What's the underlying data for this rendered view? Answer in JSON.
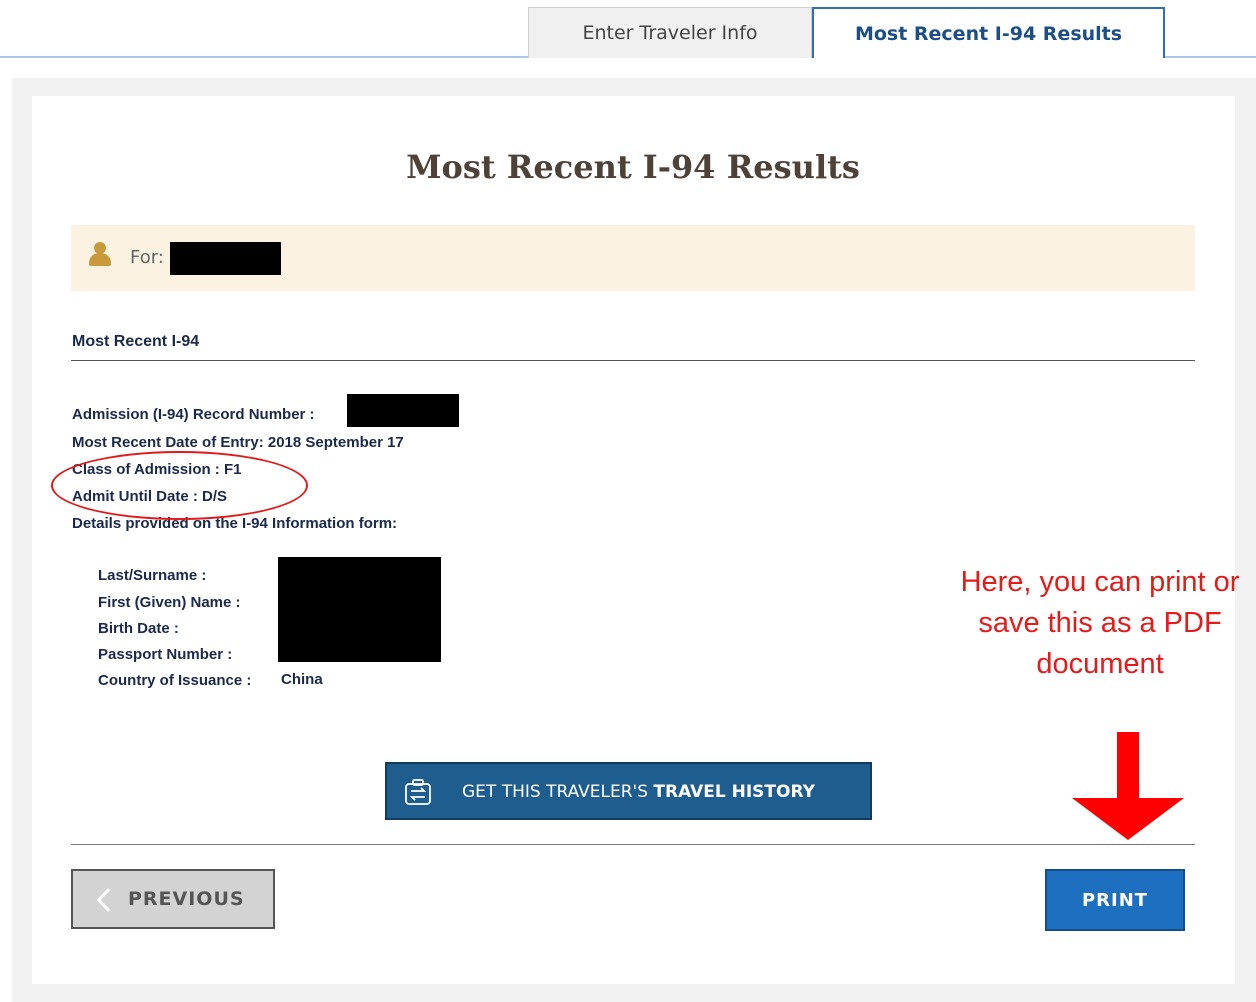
{
  "tabs": {
    "enter_traveler_info": "Enter Traveler Info",
    "most_recent_results": "Most Recent I-94 Results"
  },
  "page_title": "Most Recent I-94 Results",
  "for_banner": {
    "label": "For:",
    "icon": "user-icon"
  },
  "section": {
    "title": "Most Recent I-94",
    "record_number_label": "Admission (I-94) Record Number :",
    "date_of_entry": "Most Recent Date of Entry: 2018 September 17",
    "class_of_admission": "Class of Admission : F1",
    "admit_until": "Admit Until Date : D/S",
    "details_intro": "Details provided on the I-94 Information form:",
    "fields": [
      {
        "label": "Last/Surname :"
      },
      {
        "label": "First (Given) Name :"
      },
      {
        "label": "Birth Date :"
      },
      {
        "label": "Passport Number :"
      },
      {
        "label": "Country of Issuance :",
        "value": "China"
      }
    ]
  },
  "annotation": {
    "line1": "Here, you can print or",
    "line2": "save this as a PDF",
    "line3": "document"
  },
  "buttons": {
    "travel_history_prefix": "GET THIS TRAVELER'S ",
    "travel_history_bold": "TRAVEL HISTORY",
    "previous": "PREVIOUS",
    "print": "PRINT"
  },
  "colors": {
    "accent_blue": "#1d6fc0",
    "annotation_red": "#e51b1b",
    "banner_bg": "#fcf2e2"
  }
}
